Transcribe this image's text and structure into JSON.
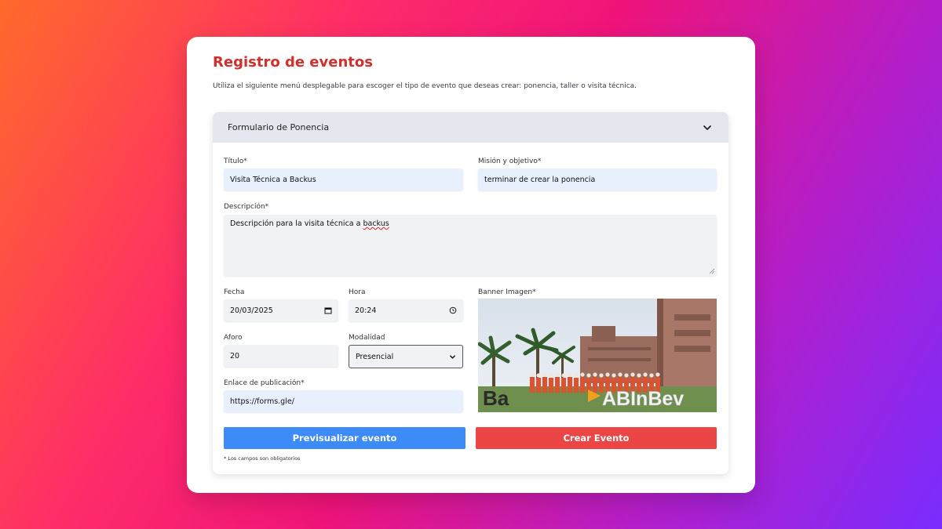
{
  "page": {
    "title": "Registro de eventos",
    "subtitle": "Utiliza el siguiente menú desplegable para escoger el tipo de evento que deseas crear: ponencia, taller o visita técnica."
  },
  "accordion": {
    "label": "Formulario de Ponencia",
    "expanded": true,
    "icon": "chevron-down-icon"
  },
  "form": {
    "titulo": {
      "label": "Título*",
      "value": "Visita Técnica a Backus"
    },
    "mision": {
      "label": "Misión y objetivo*",
      "value": "terminar de crear la ponencia"
    },
    "descripcion": {
      "label": "Descripción*",
      "value_prefix": "Descripción para la visita técnica a ",
      "value_misspelled": "backus"
    },
    "fecha": {
      "label": "Fecha",
      "value": "20/03/2025",
      "icon": "calendar-icon"
    },
    "hora": {
      "label": "Hora",
      "value": "20:24",
      "icon": "clock-icon"
    },
    "aforo": {
      "label": "Aforo",
      "value": "20"
    },
    "modalidad": {
      "label": "Modalidad",
      "value": "Presencial",
      "icon": "chevron-down-icon"
    },
    "enlace": {
      "label": "Enlace de publicación*",
      "value": "https://forms.gle/"
    },
    "banner": {
      "label": "Banner Imagen*",
      "image_text_left": "Ba",
      "image_text_right": "ABInBev"
    }
  },
  "buttons": {
    "preview": "Previsualizar evento",
    "create": "Crear Evento"
  },
  "note": "* Los campos son obligatorios",
  "colors": {
    "title": "#d0312d",
    "primary_button": "#3d8bf6",
    "danger_button": "#ec4545",
    "autofill_field": "#e8f0fe",
    "field": "#f1f2f5",
    "accordion_header": "#e4e7ee"
  }
}
